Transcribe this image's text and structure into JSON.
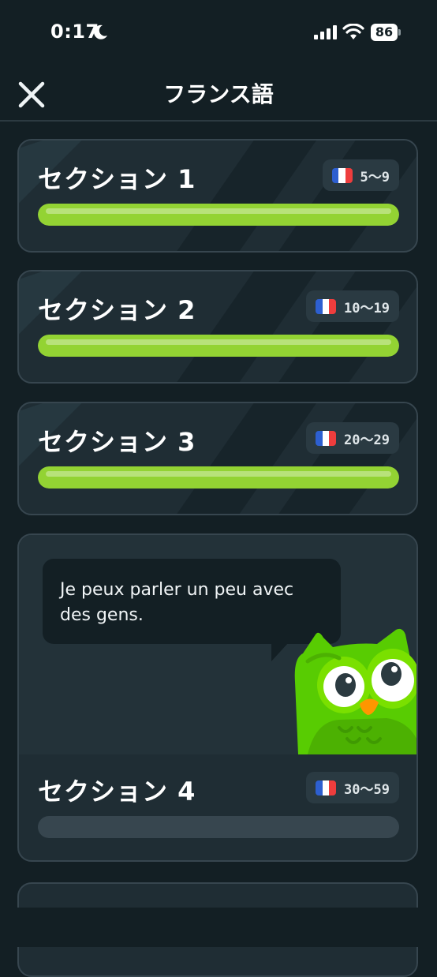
{
  "status_bar": {
    "time": "0:17",
    "battery": "86"
  },
  "header": {
    "title": "フランス語"
  },
  "sections": [
    {
      "title": "セクション 1",
      "range": "5〜9",
      "progress": 1.0
    },
    {
      "title": "セクション 2",
      "range": "10〜19",
      "progress": 1.0
    },
    {
      "title": "セクション 3",
      "range": "20〜29",
      "progress": 1.0
    },
    {
      "title": "セクション 4",
      "range": "30〜59",
      "progress": 0.0,
      "speech": "Je peux parler un peu avec des gens."
    }
  ],
  "colors": {
    "background": "#131f24",
    "card": "#1f2d34",
    "progress_fill": "#93d333",
    "progress_track": "#37464f",
    "owl_green": "#58cc02"
  },
  "icons": {
    "close": "close-icon",
    "flag": "france-flag-icon",
    "mascot": "owl-mascot"
  }
}
